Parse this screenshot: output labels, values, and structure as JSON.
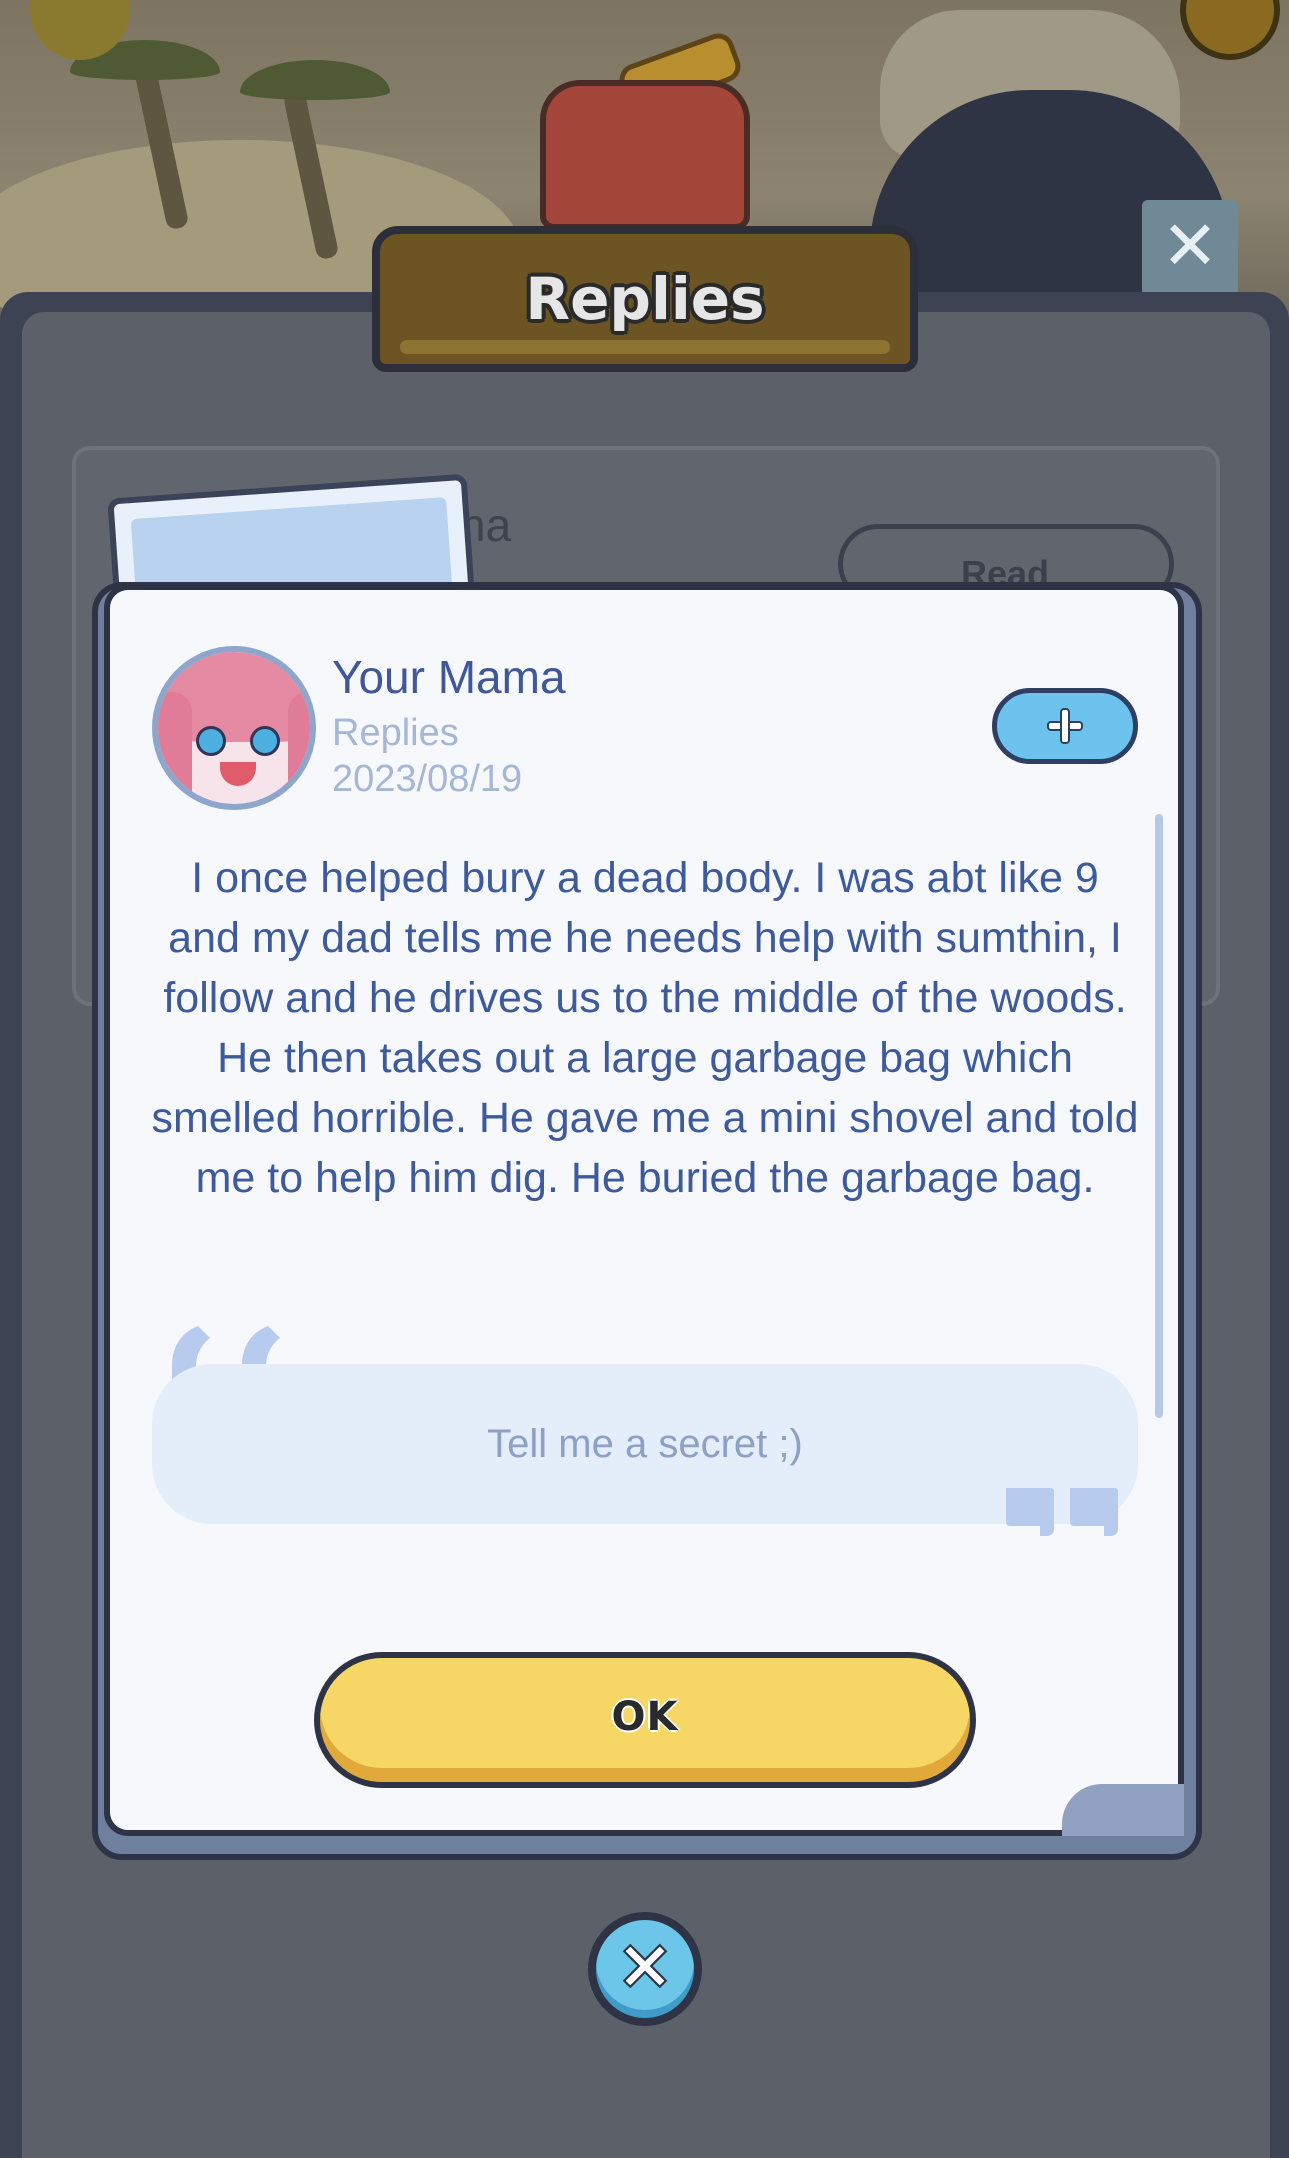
{
  "header": {
    "title": "Replies",
    "close_glyph": "✕"
  },
  "background_list": {
    "name_fragment": "na",
    "pill_label": "Read"
  },
  "reply": {
    "author_name": "Your Mama",
    "label": "Replies",
    "date": "2023/08/19",
    "message": "I once helped bury a dead body. I was abt like 9 and my dad tells me he needs help with sumthin, I follow and he drives us to the middle of the woods. He then takes out a large garbage bag which smelled horrible. He gave me a mini shovel and told me to help him dig. He buried the garbage bag.",
    "prompt": "Tell me a secret ;)",
    "avatar_icon": "anime-girl-avatar",
    "add_icon": "plus-icon"
  },
  "buttons": {
    "ok_label": "OK",
    "close_glyph": "✕"
  },
  "colors": {
    "accent_yellow": "#f6d766",
    "accent_blue": "#6cc4ee",
    "text_primary": "#3d5a9c",
    "text_muted": "#a5b7d4"
  }
}
